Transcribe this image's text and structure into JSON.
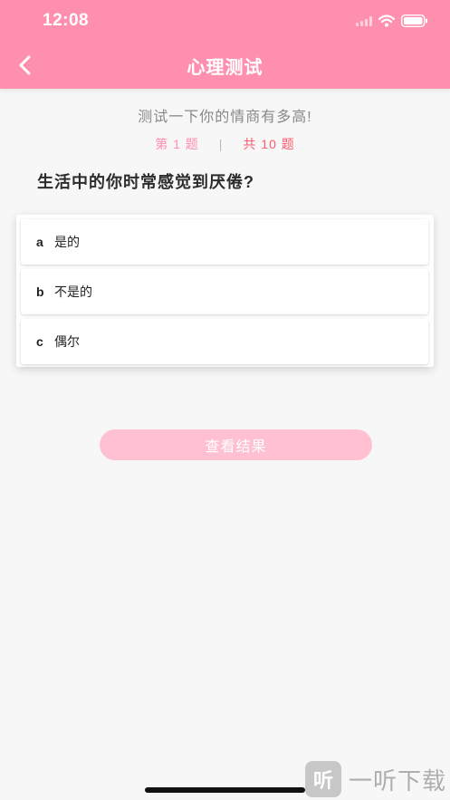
{
  "status_bar": {
    "time": "12:08"
  },
  "header": {
    "title": "心理测试"
  },
  "quiz": {
    "subtitle": "测试一下你的情商有多高!",
    "current": "第 1 题",
    "separator": "|",
    "total": "共 10 题",
    "question": "生活中的你时常感觉到厌倦?",
    "options": [
      {
        "key": "a",
        "text": "是的"
      },
      {
        "key": "b",
        "text": "不是的"
      },
      {
        "key": "c",
        "text": "偶尔"
      }
    ],
    "result_button": "查看结果"
  },
  "watermark": {
    "logo": "听",
    "text": "一听下载"
  },
  "colors": {
    "header": "#ff8fae",
    "accent": "#ff5c6c",
    "button": "#ffc1d1",
    "background": "#f7f7f7"
  },
  "icons": {
    "back": "chevron-left-icon",
    "signal": "signal-icon",
    "wifi": "wifi-icon",
    "battery": "battery-icon"
  }
}
